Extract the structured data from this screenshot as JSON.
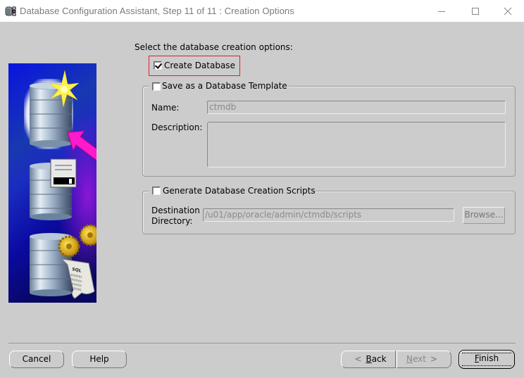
{
  "window": {
    "title": "Database Configuration Assistant, Step 11 of 11 : Creation Options",
    "app_icon": "database-app-icon",
    "controls": {
      "minimize": "minimize-icon",
      "maximize": "maximize-icon",
      "close": "close-icon"
    }
  },
  "side_image": {
    "description": "Database creation illustration",
    "elements": [
      "database-cylinder-highlighted",
      "sparkle",
      "pink-arrow",
      "database-cylinder-floppy",
      "floppy-disk",
      "database-cylinder-sql",
      "gears",
      "sql-scroll"
    ],
    "scroll_text": "SQL",
    "colors": {
      "background_top": "#0a10d8",
      "background_bottom": "#0a0a6a",
      "arrow": "#ff1acb",
      "sparkle": "#fff14a"
    }
  },
  "main": {
    "prompt": "Select the database creation options:",
    "create_database": {
      "label": "Create Database",
      "checked": true
    },
    "save_template": {
      "label": "Save as a Database Template",
      "checked": false,
      "name_label": "Name:",
      "name_value": "ctmdb",
      "description_label": "Description:",
      "description_value": ""
    },
    "generate_scripts": {
      "label": "Generate Database Creation Scripts",
      "checked": false,
      "dest_label_line1": "Destination",
      "dest_label_line2": "Directory:",
      "dest_value": "/u01/app/oracle/admin/ctmdb/scripts",
      "browse_label": "Browse..."
    },
    "highlight_color": "#e02020"
  },
  "footer": {
    "cancel": "Cancel",
    "help": "Help",
    "back_mnemonic": "B",
    "back_rest": "ack",
    "next_mnemonic": "N",
    "next_rest": "ext",
    "finish_mnemonic": "F",
    "finish_rest": "inish",
    "back_arrow": "<",
    "next_arrow": ">"
  }
}
